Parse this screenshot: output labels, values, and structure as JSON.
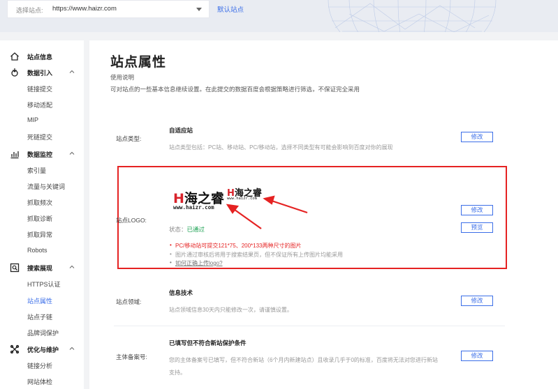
{
  "topbar": {
    "select_label": "选择站点:",
    "select_value": "https://www.haizr.com",
    "default_site": "默认站点"
  },
  "sidebar": {
    "items": [
      {
        "label": "站点信息",
        "group": true,
        "icon": "home-icon"
      },
      {
        "label": "数据引入",
        "group": true,
        "icon": "data-import-icon",
        "expanded": true
      },
      {
        "label": "链接提交"
      },
      {
        "label": "移动适配"
      },
      {
        "label": "MIP"
      },
      {
        "label": "死链提交"
      },
      {
        "label": "数据监控",
        "group": true,
        "icon": "chart-icon",
        "expanded": true
      },
      {
        "label": "索引量"
      },
      {
        "label": "流量与关键词"
      },
      {
        "label": "抓取频次"
      },
      {
        "label": "抓取诊断"
      },
      {
        "label": "抓取异常"
      },
      {
        "label": "Robots"
      },
      {
        "label": "搜索展现",
        "group": true,
        "icon": "search-display-icon",
        "expanded": true
      },
      {
        "label": "HTTPS认证"
      },
      {
        "label": "站点属性",
        "active": true
      },
      {
        "label": "站点子链"
      },
      {
        "label": "品牌词保护"
      },
      {
        "label": "优化与维护",
        "group": true,
        "icon": "tools-icon",
        "expanded": true
      },
      {
        "label": "链接分析"
      },
      {
        "label": "网站体检"
      }
    ]
  },
  "main": {
    "title": "站点属性",
    "usage_title": "使用说明",
    "usage_desc": "可对站点的一些基本信息继续设置。在此提交的数据百度会根据策略进行筛选，不保证完全采用",
    "site_type": {
      "label": "站点类型:",
      "value": "自适应站",
      "desc": "站点类型包括：PC站、移动站、PC/移动站，选择不同类型有可能会影响到百度对你的展现",
      "button": "修改"
    },
    "site_logo": {
      "label": "站点LOGO:",
      "logo_text": "海之睿",
      "logo_h": "H",
      "logo_url_big": "www.haizr.com",
      "logo_url_small": "www.haizr.com",
      "status_label": "状态：",
      "status_value": "已通过",
      "tips": [
        "PC/移动站可提交121*75、200*133两种尺寸的图片",
        "图片通过审核后将用于搜索结果页，但不保证所有上传图片均能采用",
        "如何正确上传logo?"
      ],
      "button_edit": "修改",
      "button_preview": "预览"
    },
    "site_domain": {
      "label": "站点领域:",
      "value": "信息技术",
      "desc": "站点领域信息30天内只能修改一次，请谨慎设置。",
      "button": "修改"
    },
    "icp": {
      "label": "主体备案号:",
      "value": "已填写但不符合新站保护条件",
      "desc_line1": "您的主体备案号已填写，但不符合新站（6个月内新建站点）且收录几乎于0的标准，百度将无法对您进行新站",
      "desc_line2": "支持。",
      "button": "修改"
    }
  },
  "colors": {
    "accent": "#3b6ee8",
    "highlight_border": "#e52222",
    "success": "#1aa051"
  }
}
